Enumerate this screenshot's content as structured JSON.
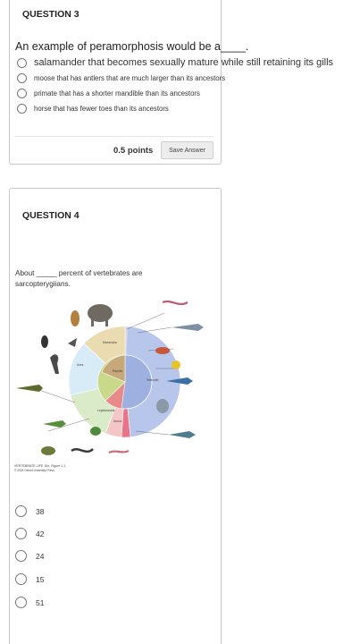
{
  "q3": {
    "title": "QUESTION 3",
    "prompt": "An example of peramorphosis would be a____.",
    "options": [
      "salamander that becomes sexually mature while still retaining its gills",
      "moose that has antlers that are much larger than its ancestors",
      "primate that has a shorter mandible than its ancestors",
      "horse that has fewer toes than its ancestors"
    ],
    "points": "0.5 points",
    "save_label": "Save Answer"
  },
  "q4": {
    "title": "QUESTION 4",
    "prompt": "About _____ percent of vertebrates are sarcopterygiians.",
    "choices": [
      "38",
      "42",
      "24",
      "15",
      "51"
    ]
  },
  "figure": {
    "credit_line1": "VERTEBRATE LIFE 10e, Figure 1.1",
    "credit_line2": "© 2018 Oxford University Press",
    "colors": {
      "actinopterygii": "#b7c6ea",
      "teleost_core": "#9db0e0",
      "mammals": "#eadcb0",
      "birds": "#d7ecf6",
      "reptiles": "#d9ebc8",
      "lepidosaurs": "#bcd9a2",
      "amphibians": "#f4c6c6",
      "caecilians": "#e9748a",
      "chondrichthyes": "#d8d8e6"
    }
  }
}
